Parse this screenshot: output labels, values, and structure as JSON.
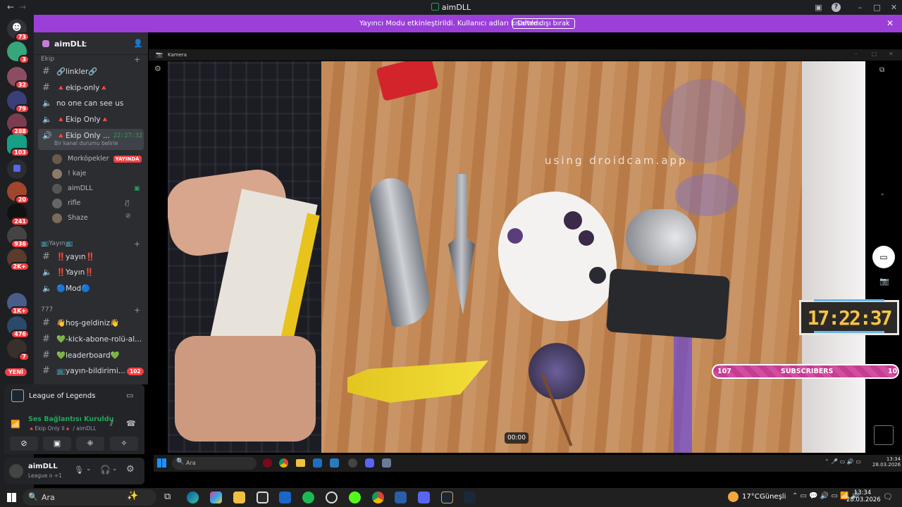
{
  "window": {
    "title": "aimDLL",
    "back": "←",
    "forward": "→"
  },
  "banner": {
    "text": "Yayıncı Modu etkinleştirildi. Kullanıcı adları kısaltıldı.",
    "button": "Devre dışı bırak"
  },
  "rail": {
    "badges": [
      "73",
      "3",
      "32",
      "79",
      "288",
      "103",
      "20",
      "241",
      "936",
      "2K+",
      "1K+",
      "476",
      "7"
    ],
    "new_label": "YENİ"
  },
  "server": {
    "name": "aimDLL"
  },
  "categories": {
    "ekip": "Ekip",
    "yayin": "📺Yayın📺",
    "c777": "777"
  },
  "channels": [
    {
      "name": "🔗linkler🔗",
      "type": "text"
    },
    {
      "name": "🔺ekip-only🔺",
      "type": "text"
    },
    {
      "name": "no one can see us",
      "type": "voice"
    },
    {
      "name": "🔺Ekip Only🔺",
      "type": "voice"
    },
    {
      "name": "🔺Ekip Only ...",
      "type": "voice-active",
      "time": "22:27:32",
      "status": "Bir kanal durumu belirle"
    }
  ],
  "voice_members": [
    {
      "name": "Morköpekler",
      "badge": "YAYINDA"
    },
    {
      "name": "! kaje"
    },
    {
      "name": "aimDLL"
    },
    {
      "name": "rifle"
    },
    {
      "name": "Shaze"
    }
  ],
  "yayin_channels": [
    {
      "name": "‼️yayın‼️",
      "type": "text"
    },
    {
      "name": "‼️Yayın‼️",
      "type": "voice"
    },
    {
      "name": "🔵Mod🔵",
      "type": "voice"
    }
  ],
  "c777_channels": [
    {
      "name": "👋hoş-geldiniz👋",
      "type": "text"
    },
    {
      "name": "💚-kick-abone-rolü-al...",
      "type": "text"
    },
    {
      "name": "💚leaderboard💚",
      "type": "text"
    },
    {
      "name": "📺yayın-bildirimi...",
      "type": "text",
      "badge": "102"
    }
  ],
  "game": {
    "name": "League of Legends"
  },
  "voice_panel": {
    "status": "Ses Bağlantısı Kuruldu",
    "channel": "🔺Ekip Only II🔺 / aimDLL"
  },
  "user_panel": {
    "name": "aimDLL",
    "activity": "League o +1"
  },
  "camera": {
    "window_title": "Kamera",
    "watermark": "using droidcam.app",
    "time": "00:00",
    "clock": "17:22:37"
  },
  "subscribers": {
    "left": "107",
    "label": "SUBSCRIBERS",
    "right": "10"
  },
  "inner_taskbar": {
    "search": "Ara",
    "time": "13:34",
    "date": "28.03.2026"
  },
  "taskbar": {
    "search": "Ara",
    "weather": "17°C",
    "weather_text": "Güneşli",
    "time": "13:34",
    "date": "28.03.2026"
  }
}
